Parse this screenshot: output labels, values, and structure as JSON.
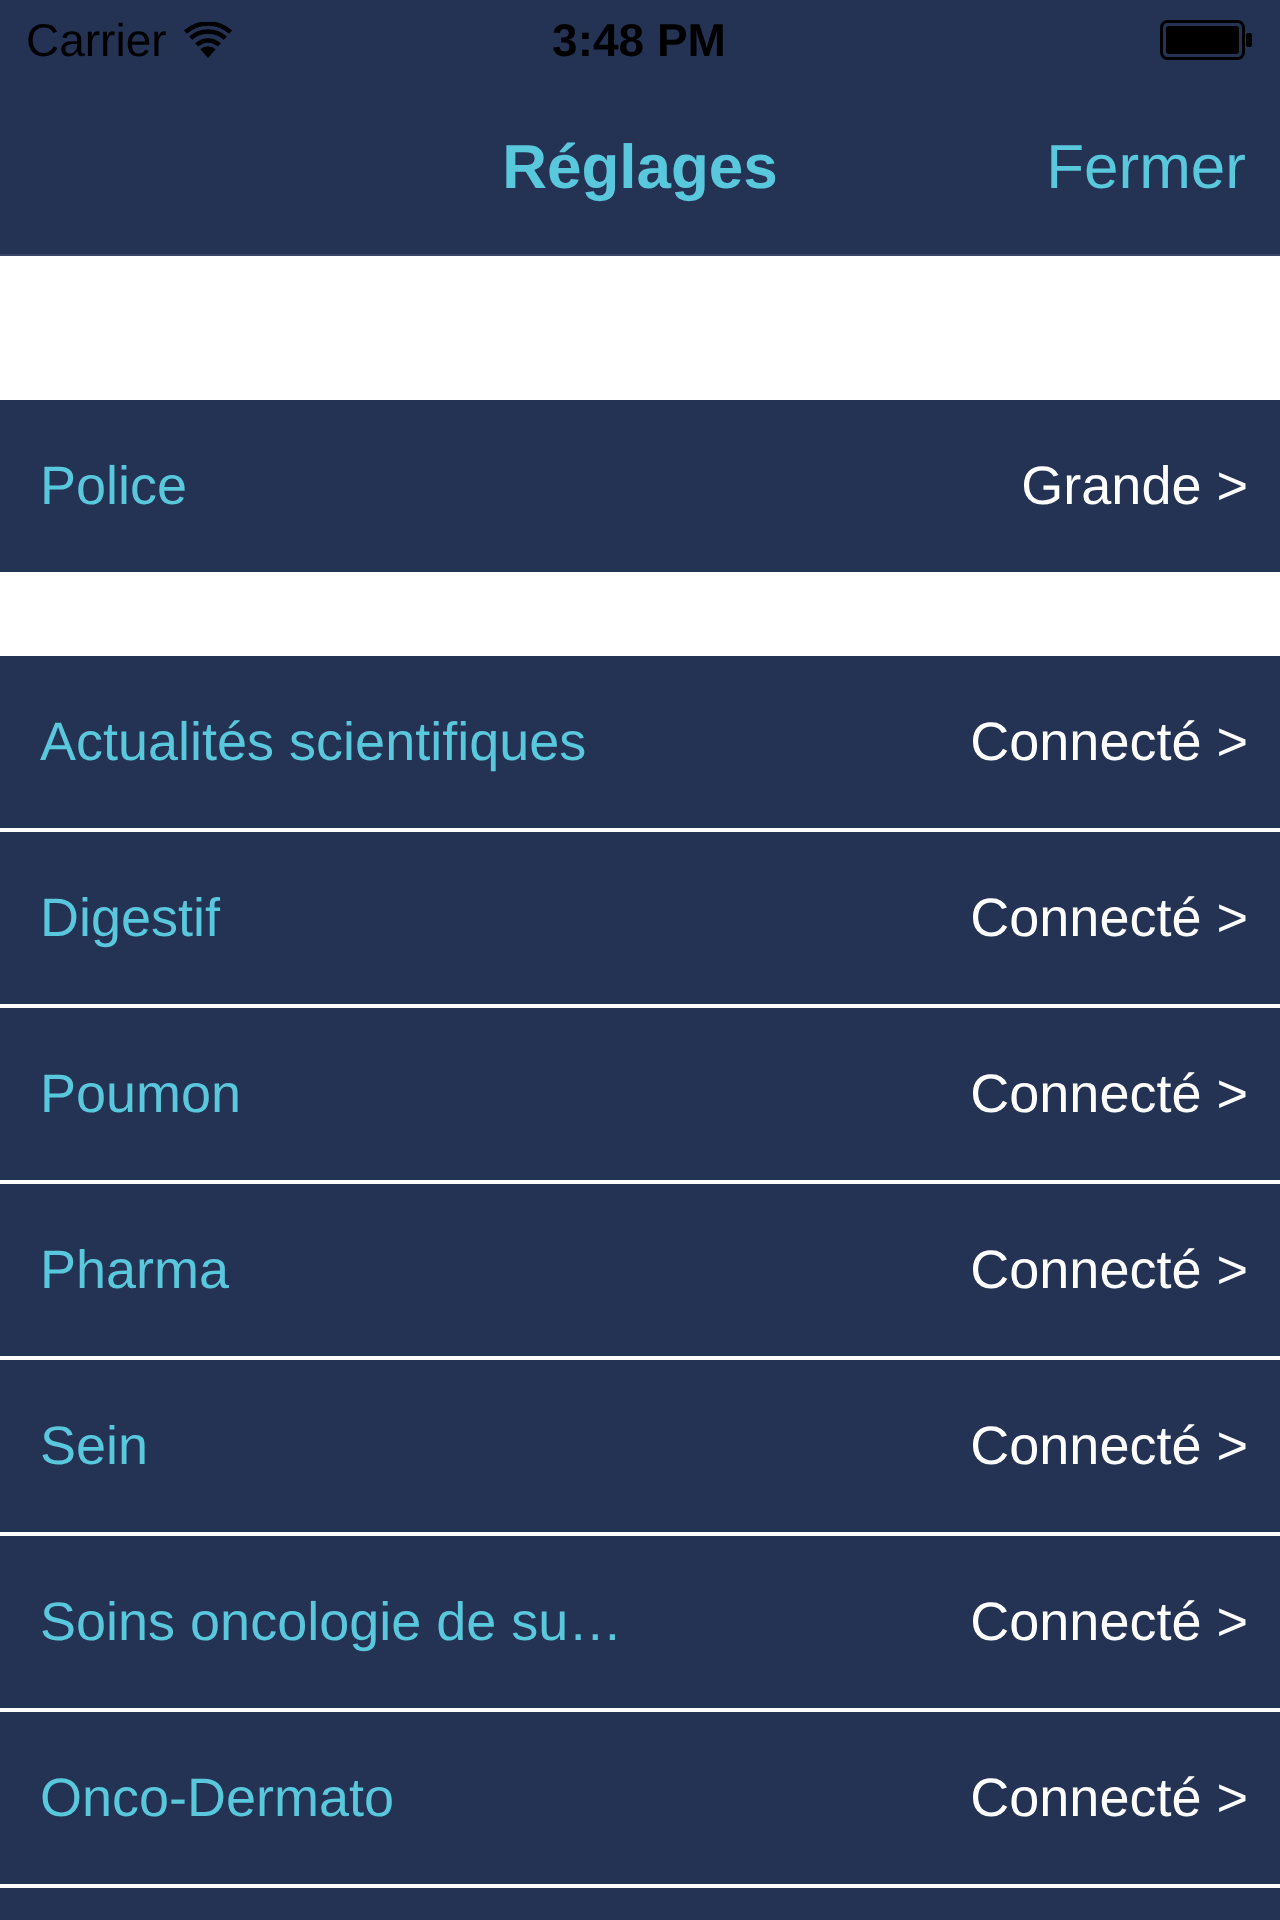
{
  "status_bar": {
    "carrier": "Carrier",
    "time": "3:48 PM"
  },
  "nav_bar": {
    "title": "Réglages",
    "close_button": "Fermer"
  },
  "sections": [
    {
      "rows": [
        {
          "label": "Police",
          "value": "Grande >"
        }
      ]
    },
    {
      "rows": [
        {
          "label": "Actualités scientifiques",
          "value": "Connecté >"
        },
        {
          "label": "Digestif",
          "value": "Connecté >"
        },
        {
          "label": "Poumon",
          "value": "Connecté >"
        },
        {
          "label": "Pharma",
          "value": "Connecté >"
        },
        {
          "label": "Sein",
          "value": "Connecté >"
        },
        {
          "label": "Soins oncologie de su…",
          "value": "Connecté >"
        },
        {
          "label": "Onco-Dermato",
          "value": "Connecté >"
        }
      ]
    }
  ]
}
